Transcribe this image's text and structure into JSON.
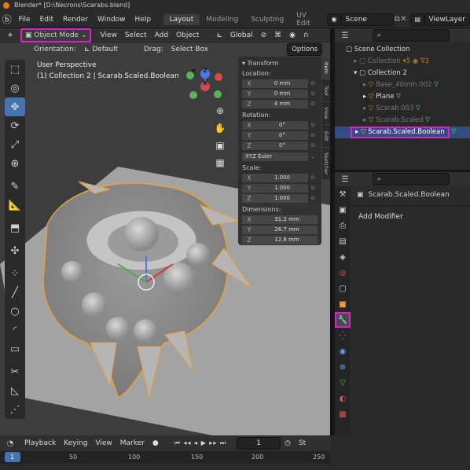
{
  "window": {
    "title": "Blender* [D:\\Necrons\\Scarabs.blend]"
  },
  "menu": {
    "items": [
      "File",
      "Edit",
      "Render",
      "Window",
      "Help"
    ]
  },
  "workspaces": {
    "tabs": [
      "Layout",
      "Modeling",
      "Sculpting",
      "UV Edit"
    ]
  },
  "scene": {
    "name": "Scene",
    "view_layer": "ViewLayer"
  },
  "viewport_header": {
    "mode": "Object Mode",
    "menus": [
      "View",
      "Select",
      "Add",
      "Object"
    ],
    "transform_orientation": "Global"
  },
  "viewport_header2": {
    "orientation_label": "Orientation:",
    "orientation_value": "Default",
    "drag_label": "Drag:",
    "drag_value": "Select Box",
    "options": "Options"
  },
  "viewport": {
    "perspective": "User Perspective",
    "collection_line": "(1) Collection 2 | Scarab.Scaled.Boolean",
    "gizmo": {
      "x": "X",
      "y": "Y",
      "z": "Z"
    }
  },
  "npanel": {
    "header": "Transform",
    "location_label": "Location:",
    "location": [
      {
        "axis": "X",
        "value": "0 mm"
      },
      {
        "axis": "Y",
        "value": "0 mm"
      },
      {
        "axis": "Z",
        "value": "4 mm"
      }
    ],
    "rotation_label": "Rotation:",
    "rotation": [
      {
        "axis": "X",
        "value": "0°"
      },
      {
        "axis": "Y",
        "value": "0°"
      },
      {
        "axis": "Z",
        "value": "0°"
      }
    ],
    "rotation_mode": "XYZ Euler",
    "scale_label": "Scale:",
    "scale": [
      {
        "axis": "X",
        "value": "1.000"
      },
      {
        "axis": "Y",
        "value": "1.000"
      },
      {
        "axis": "Z",
        "value": "1.000"
      }
    ],
    "dimensions_label": "Dimensions:",
    "dimensions": [
      {
        "axis": "X",
        "value": "31.2 mm"
      },
      {
        "axis": "Y",
        "value": "26.7 mm"
      },
      {
        "axis": "Z",
        "value": "12.8 mm"
      }
    ],
    "tabs": [
      "Item",
      "Tool",
      "View",
      "Edit",
      "Sketcher"
    ]
  },
  "outliner": {
    "rows": [
      "Scene Collection",
      "Collection",
      "Collection 2",
      "Base_40mm.002",
      "Plane",
      "Scarab.003",
      "Scarab.Scaled",
      "Scarab.Scaled.Boolean"
    ]
  },
  "properties": {
    "object_name": "Scarab.Scaled.Boolean",
    "add_modifier": "Add Modifier"
  },
  "timeline": {
    "menus": [
      "Playback",
      "Keying",
      "View",
      "Marker"
    ],
    "current_frame": "1",
    "ruler": [
      "1",
      "50",
      "100",
      "150",
      "200",
      "250"
    ],
    "start_label": "St"
  },
  "colors": {
    "accent": "#4772b3",
    "highlight": "#e020d0",
    "selection": "#e8a03a"
  }
}
